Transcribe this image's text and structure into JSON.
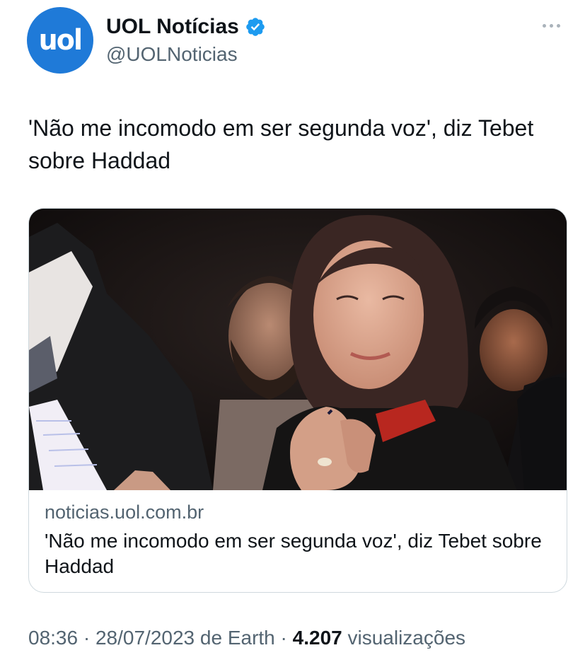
{
  "author": {
    "name": "UOL Notícias",
    "handle": "@UOLNoticias",
    "avatar_text": "uol",
    "verified": true,
    "verified_icon": "verified-badge-icon",
    "avatar_color": "#1f7ad8",
    "badge_color": "#1d9bf0"
  },
  "more_icon": "more-dots-icon",
  "tweet": {
    "text": "'Não me incomodo em ser segunda voz', diz Tebet sobre Haddad"
  },
  "card": {
    "domain": "noticias.uol.com.br",
    "title": "'Não me incomodo em ser segunda voz', diz Tebet sobre Haddad"
  },
  "meta": {
    "time": "08:36",
    "date": "28/07/2023",
    "source": "de Earth",
    "views_count": "4.207",
    "views_label": "visualizações"
  }
}
